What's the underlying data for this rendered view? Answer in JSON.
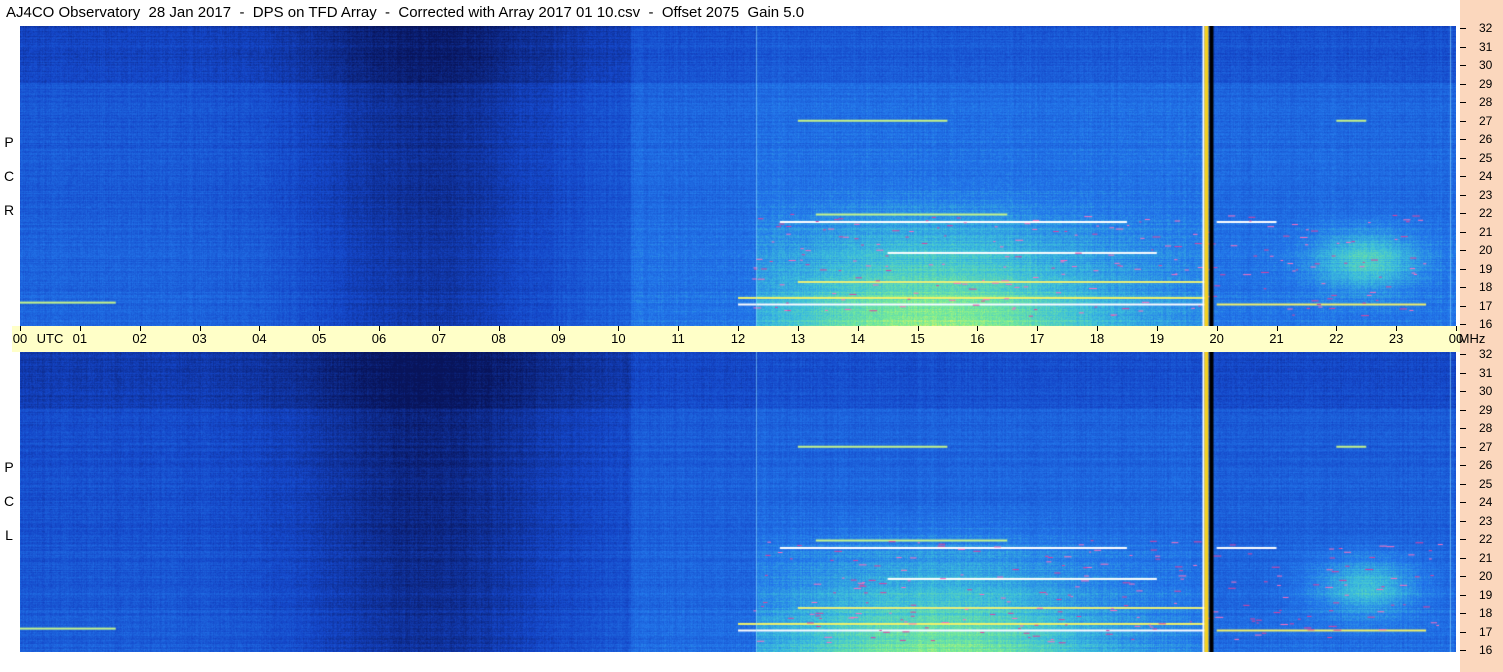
{
  "title": "AJ4CO Observatory  28 Jan 2017  -  DPS on TFD Array  -  Corrected with Array 2017 01 10.csv  -  Offset 2075  Gain 5.0",
  "chart_data": [
    {
      "type": "heatmap",
      "polarization": "RCP",
      "label_letters": [
        "R",
        "C",
        "P"
      ],
      "x_unit": "UTC",
      "y_unit": "MHz",
      "xlim": [
        0,
        24
      ],
      "ylim": [
        16,
        32
      ],
      "description_of_features": [
        {
          "utc_start": 0.0,
          "utc_end": 10.2,
          "level": "low",
          "note": "quiet background, darkest near 05-08 UTC"
        },
        {
          "utc_start": 10.2,
          "utc_end": 12.3,
          "level": "medium-low",
          "note": "slightly brighter band"
        },
        {
          "utc_start": 12.3,
          "utc_end": 19.8,
          "level": "high",
          "note": "elevated noise, strongest below 22 MHz"
        },
        {
          "utc_start": 19.82,
          "utc_end": 19.92,
          "level": "marker",
          "note": "vertical yellow/black line"
        },
        {
          "utc_start": 19.92,
          "utc_end": 24.0,
          "level": "medium",
          "note": "moderate noise with bright patch 21.5-23.5 UTC at 18-21 MHz"
        }
      ]
    },
    {
      "type": "heatmap",
      "polarization": "LCP",
      "label_letters": [
        "L",
        "C",
        "P"
      ],
      "x_unit": "UTC",
      "y_unit": "MHz",
      "xlim": [
        0,
        24
      ],
      "ylim": [
        16,
        32
      ],
      "description_of_features": [
        {
          "utc_start": 0.0,
          "utc_end": 10.2,
          "level": "low",
          "note": "quiet background, darkest near 05-08 UTC"
        },
        {
          "utc_start": 10.2,
          "utc_end": 12.3,
          "level": "medium-low",
          "note": "slightly brighter band"
        },
        {
          "utc_start": 12.3,
          "utc_end": 19.8,
          "level": "high",
          "note": "elevated noise, strongest below 22 MHz"
        },
        {
          "utc_start": 19.82,
          "utc_end": 19.92,
          "level": "marker",
          "note": "vertical yellow/black line"
        },
        {
          "utc_start": 19.92,
          "utc_end": 24.0,
          "level": "medium",
          "note": "moderate noise with bright patch 21.5-23.5 UTC at 18-21 MHz"
        }
      ]
    }
  ],
  "time_axis": {
    "labels": [
      "00",
      "UTC",
      "01",
      "02",
      "03",
      "04",
      "05",
      "06",
      "07",
      "08",
      "09",
      "10",
      "11",
      "12",
      "13",
      "14",
      "15",
      "16",
      "17",
      "18",
      "19",
      "20",
      "21",
      "22",
      "23",
      "00",
      "MHz"
    ]
  },
  "freq_axis": {
    "ticks": [
      32,
      31,
      30,
      29,
      28,
      27,
      26,
      25,
      24,
      23,
      22,
      21,
      20,
      19,
      18,
      17,
      16
    ],
    "labels": [
      "32",
      "31",
      "30",
      "29",
      "28",
      "27",
      "26",
      "25",
      "24",
      "23",
      "22",
      "21",
      "20",
      "19",
      "18",
      "17",
      "16"
    ]
  },
  "colors": {
    "background_low": "#0a2a7a",
    "background_mid": "#1f62d8",
    "background_high": "#7be0c0",
    "peak": "#f4f46a",
    "axis_band": "#ffffc8",
    "right_strip": "#fbd7bd"
  }
}
